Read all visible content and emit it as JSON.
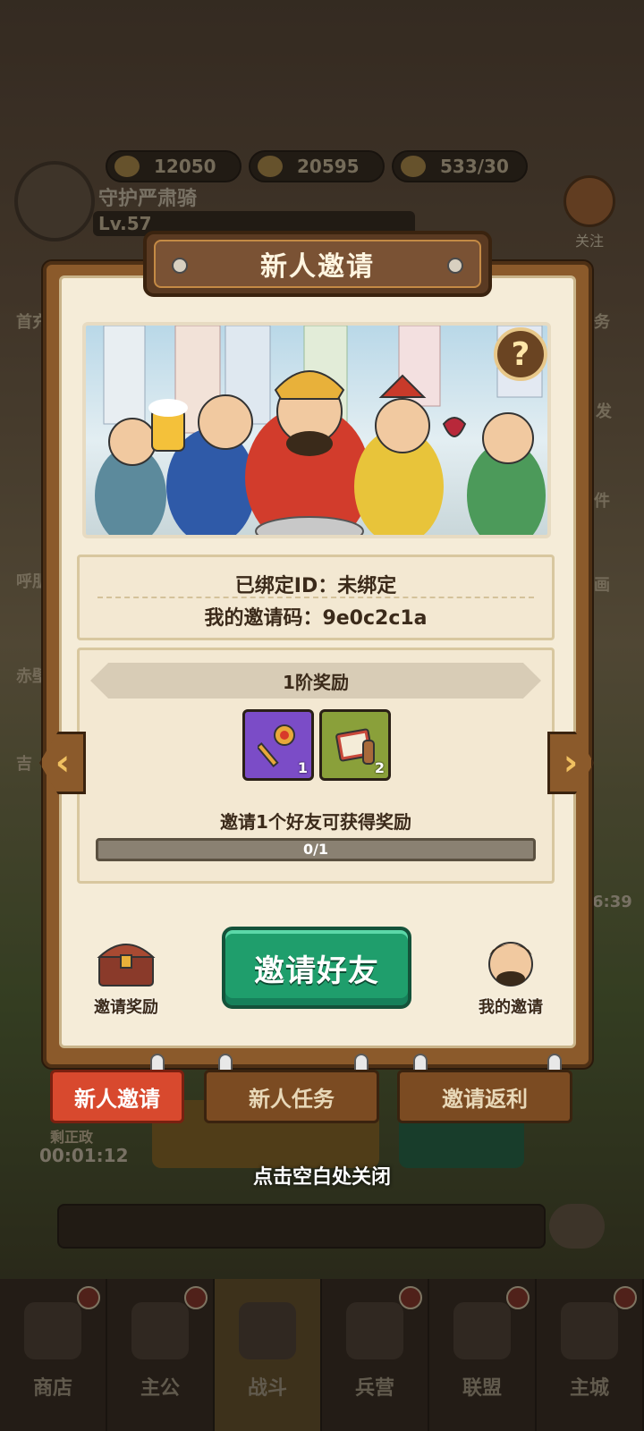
{
  "background": {
    "resources": [
      {
        "value": "12050",
        "icon": "gold-ingot-icon"
      },
      {
        "value": "20595",
        "icon": "coin-icon"
      },
      {
        "value": "533/30",
        "icon": "food-bowl-icon"
      }
    ],
    "player": {
      "name": "守护严肃骑",
      "level": "Lv.57"
    },
    "follow_label": "关注",
    "side_left_labels": [
      "首充",
      "呼朋",
      "赤壁",
      "吉"
    ],
    "side_right_labels": [
      "务",
      "发",
      "件",
      "画"
    ],
    "timer_left": "00:01:12",
    "timer_left_label": "剩正政",
    "timer_right": "6:39",
    "nav": [
      {
        "label": "商店",
        "badge": true
      },
      {
        "label": "主公",
        "badge": true
      },
      {
        "label": "战斗",
        "badge": false,
        "active": true
      },
      {
        "label": "兵营",
        "badge": true
      },
      {
        "label": "联盟",
        "badge": true
      },
      {
        "label": "主城",
        "badge": true
      }
    ]
  },
  "modal": {
    "title": "新人邀请",
    "help_label": "?",
    "bound_id_line": "已绑定ID：未绑定",
    "invite_code_line": "我的邀请码：9e0c2c1a",
    "tier_title": "1阶奖励",
    "rewards": [
      {
        "icon": "golden-key-icon",
        "count": "1",
        "color": "#7b4cc7"
      },
      {
        "icon": "letter-scroll-icon",
        "count": "2",
        "color": "#8aa03a"
      }
    ],
    "condition_text": "邀请1个好友可获得奖励",
    "progress_text": "0/1",
    "progress_fraction": 0,
    "invite_reward_label": "邀请奖励",
    "invite_friends_label": "邀请好友",
    "my_invites_label": "我的邀请",
    "prev_arrow": "‹",
    "next_arrow": "›"
  },
  "tabs": [
    {
      "label": "新人邀请",
      "active": true
    },
    {
      "label": "新人任务",
      "active": false
    },
    {
      "label": "邀请返利",
      "active": false
    }
  ],
  "close_hint": "点击空白处关闭"
}
